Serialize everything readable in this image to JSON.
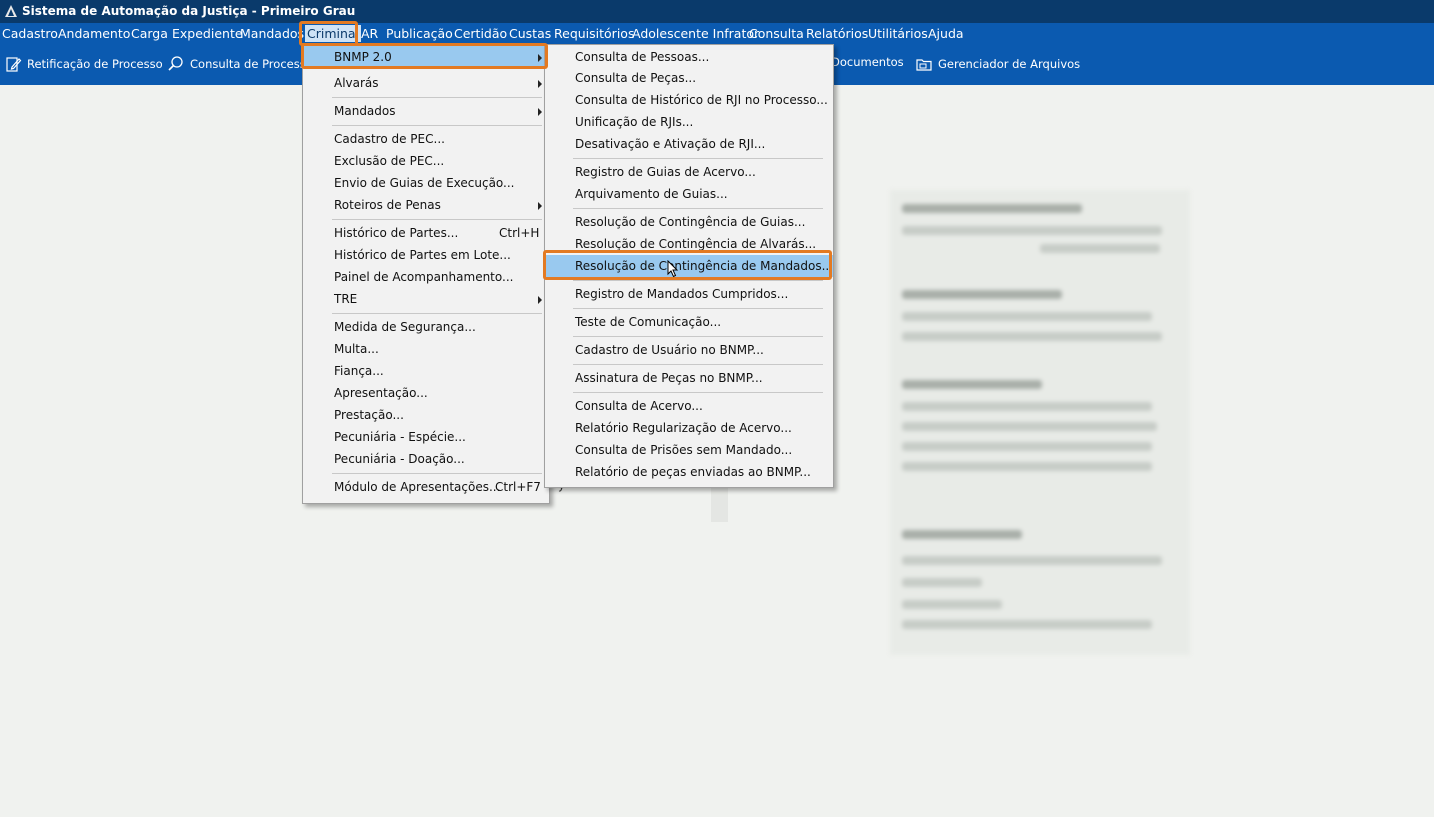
{
  "window": {
    "title": "Sistema de Automação da Justiça - Primeiro Grau"
  },
  "menubar": {
    "items": [
      {
        "label": "Cadastro"
      },
      {
        "label": "Andamento"
      },
      {
        "label": "Carga"
      },
      {
        "label": "Expediente"
      },
      {
        "label": "Mandados"
      },
      {
        "label": "Criminal"
      },
      {
        "label": "AR"
      },
      {
        "label": "Publicação"
      },
      {
        "label": "Certidão"
      },
      {
        "label": "Custas"
      },
      {
        "label": "Requisitórios"
      },
      {
        "label": "Adolescente Infrator"
      },
      {
        "label": "Consulta"
      },
      {
        "label": "Relatórios"
      },
      {
        "label": "Utilitários"
      },
      {
        "label": "Ajuda"
      }
    ]
  },
  "toolbar": {
    "items": [
      {
        "label": "Retificação de Processo",
        "icon": "edit-document-icon"
      },
      {
        "label": "Consulta de Processos",
        "icon": "search-icon"
      },
      {
        "label": "Documentos",
        "icon": "documents-icon"
      },
      {
        "label": "Gerenciador de Arquivos",
        "icon": "folder-icon"
      }
    ]
  },
  "criminal_menu": {
    "items": [
      {
        "label": "BNMP 2.0",
        "submenu": true
      },
      {
        "label": "Alvarás",
        "submenu": true
      },
      {
        "label": "Mandados",
        "submenu": true
      },
      {
        "label": "Cadastro de PEC..."
      },
      {
        "label": "Exclusão de PEC..."
      },
      {
        "label": "Envio de Guias de Execução..."
      },
      {
        "label": "Roteiros de Penas",
        "submenu": true
      },
      {
        "label": "Histórico de Partes...",
        "shortcut": "Ctrl+H"
      },
      {
        "label": "Histórico de Partes em Lote..."
      },
      {
        "label": "Painel de Acompanhamento..."
      },
      {
        "label": "TRE",
        "submenu": true
      },
      {
        "label": "Medida de Segurança..."
      },
      {
        "label": "Multa..."
      },
      {
        "label": "Fiança..."
      },
      {
        "label": "Apresentação..."
      },
      {
        "label": "Prestação..."
      },
      {
        "label": "Pecuniária - Espécie..."
      },
      {
        "label": "Pecuniária - Doação..."
      },
      {
        "label": "Módulo de Apresentações...",
        "shortcut": "Ctrl+F7"
      }
    ]
  },
  "bnmp_menu": {
    "items": [
      {
        "label": "Consulta de Pessoas..."
      },
      {
        "label": "Consulta de Peças..."
      },
      {
        "label": "Consulta de Histórico de RJI no Processo..."
      },
      {
        "label": "Unificação de RJIs..."
      },
      {
        "label": "Desativação e Ativação de RJI..."
      },
      {
        "label": "Registro de Guias de Acervo..."
      },
      {
        "label": "Arquivamento de Guias..."
      },
      {
        "label": "Resolução de Contingência de Guias..."
      },
      {
        "label": "Resolução de Contingência de Alvarás..."
      },
      {
        "label": "Resolução de Contingência de Mandados..."
      },
      {
        "label": "Registro de Mandados Cumpridos..."
      },
      {
        "label": "Teste de Comunicação..."
      },
      {
        "label": "Cadastro de Usuário no BNMP..."
      },
      {
        "label": "Assinatura de Peças no BNMP..."
      },
      {
        "label": "Consulta de Acervo..."
      },
      {
        "label": "Relatório Regularização de Acervo..."
      },
      {
        "label": "Consulta de Prisões sem Mandado..."
      },
      {
        "label": "Relatório de peças enviadas ao BNMP..."
      }
    ]
  },
  "background": {
    "partial_text": "y"
  },
  "colors": {
    "titlebar": "#0a3a6b",
    "menubar": "#0b5ab0",
    "highlight": "#99c9ef",
    "annotation": "#e37a22"
  }
}
